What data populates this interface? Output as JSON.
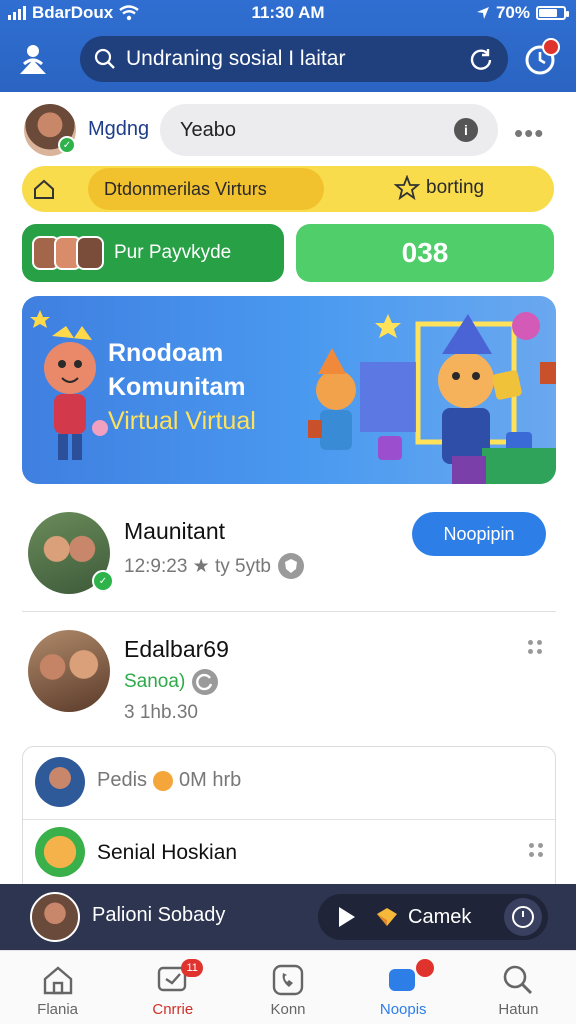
{
  "colors": {
    "header_blue": "#2f6fd1",
    "search_bg": "#1f3f7d",
    "accent_yellow": "#f9dc4c",
    "green_dark": "#27a046",
    "green_light": "#4fce6a",
    "join_blue": "#2d7ee6",
    "player_bg": "#2d3550",
    "badge_red": "#e0332d"
  },
  "status": {
    "carrier": "BdarDoux",
    "time": "11:30 AM",
    "battery": "70%",
    "battery_level": 0.7
  },
  "header": {
    "logo_icon": "person-pin-icon",
    "search_text": "Undraning sosial I laitar",
    "refresh_icon": "refresh-icon",
    "notification_icon": "notification-icon"
  },
  "user_row": {
    "name": "Mgdng",
    "input_value": "Yeabo",
    "info_icon": "info-icon",
    "more_icon": "more-icon"
  },
  "filter_bar": {
    "home_icon": "home-icon",
    "active_label": "Dtdonmerilas Virturs",
    "secondary_label": "borting",
    "star_icon": "star-icon"
  },
  "actions": {
    "left_label": "Pur Payvkyde",
    "right_value": "038"
  },
  "banner": {
    "line1": "Rnodoam",
    "line2": "Komunitam",
    "line3_a": "Virtual",
    "line3_b": "Virtual"
  },
  "list": [
    {
      "name": "Maunitant",
      "meta": "12:9:23 ★ ty 5ytb",
      "button": "Noopipin"
    },
    {
      "name": "Edalbar69",
      "status": "Sanoa)",
      "time": "3 1hb.30"
    }
  ],
  "card": {
    "row1_text_a": "Pedis",
    "row1_text_b": "0M hrb",
    "row2_text": "Senial Hoskian"
  },
  "player": {
    "name": "Palioni Sobady",
    "action_label": "Camek"
  },
  "nav": [
    {
      "label": "Flania",
      "icon": "home-icon"
    },
    {
      "label": "Cnrrie",
      "icon": "chat-icon",
      "badge": "11"
    },
    {
      "label": "Konn",
      "icon": "phone-icon"
    },
    {
      "label": "Noopis",
      "icon": "message-icon",
      "active": true
    },
    {
      "label": "Hatun",
      "icon": "search-icon"
    }
  ]
}
